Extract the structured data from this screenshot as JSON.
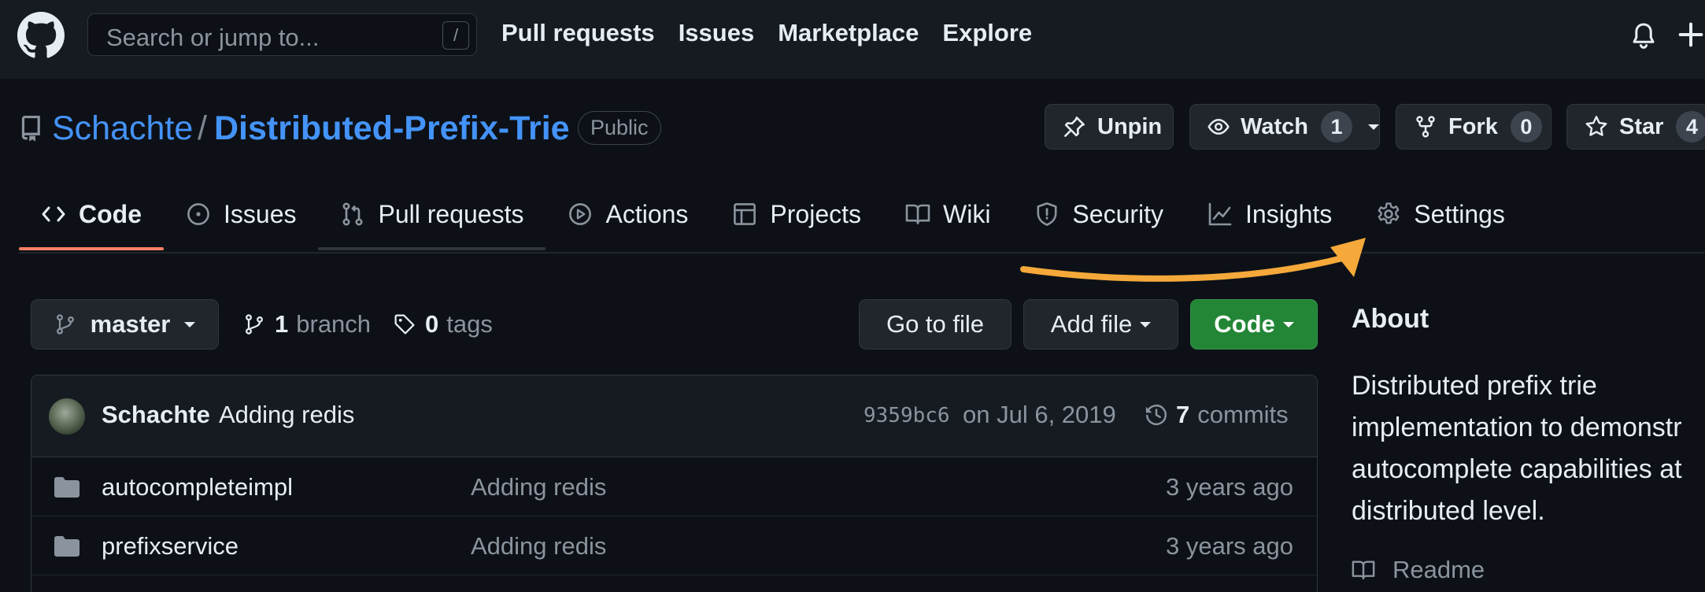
{
  "header": {
    "search_placeholder": "Search or jump to...",
    "search_shortcut": "/",
    "nav": [
      "Pull requests",
      "Issues",
      "Marketplace",
      "Explore"
    ]
  },
  "repo": {
    "owner": "Schachte",
    "separator": "/",
    "name": "Distributed-Prefix-Trie",
    "visibility": "Public",
    "unpin_label": "Unpin",
    "watch_label": "Watch",
    "watch_count": "1",
    "fork_label": "Fork",
    "fork_count": "0",
    "star_label": "Star",
    "star_count": "4"
  },
  "tabs": [
    {
      "label": "Code",
      "icon": "code-icon",
      "selected": true
    },
    {
      "label": "Issues",
      "icon": "issue-icon"
    },
    {
      "label": "Pull requests",
      "icon": "pull-request-icon"
    },
    {
      "label": "Actions",
      "icon": "play-icon"
    },
    {
      "label": "Projects",
      "icon": "table-icon"
    },
    {
      "label": "Wiki",
      "icon": "book-icon"
    },
    {
      "label": "Security",
      "icon": "shield-icon"
    },
    {
      "label": "Insights",
      "icon": "graph-icon"
    },
    {
      "label": "Settings",
      "icon": "gear-icon"
    }
  ],
  "filenav": {
    "branch": "master",
    "branch_count": "1",
    "branch_word": "branch",
    "tag_count": "0",
    "tag_word": "tags",
    "go_to_file": "Go to file",
    "add_file": "Add file",
    "code": "Code"
  },
  "commit": {
    "author": "Schachte",
    "message": "Adding redis",
    "sha": "9359bc6",
    "date": "on Jul 6, 2019",
    "count": "7",
    "count_word": "commits"
  },
  "files": [
    {
      "name": "autocompleteimpl",
      "commit": "Adding redis",
      "age": "3 years ago",
      "icon": "folder-icon"
    },
    {
      "name": "prefixservice",
      "commit": "Adding redis",
      "age": "3 years ago",
      "icon": "folder-icon"
    }
  ],
  "about": {
    "title": "About",
    "description_lines": [
      "Distributed prefix trie",
      "implementation to demonstr",
      "autocomplete capabilities at",
      "distributed level."
    ],
    "readme": "Readme"
  },
  "colors": {
    "background": "#0d1117",
    "header": "#161b22",
    "link": "#4493f8",
    "primary_button": "#238636",
    "selected_tab_underline": "#f78166",
    "annotation_arrow": "#f5a93a"
  }
}
